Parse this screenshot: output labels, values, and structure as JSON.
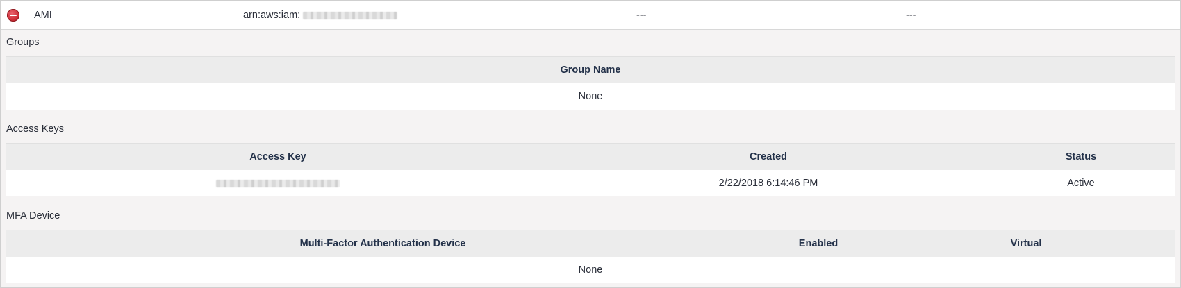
{
  "user_row": {
    "name": "AMI",
    "arn_prefix": "arn:aws:iam:",
    "col3": "---",
    "col4": "---"
  },
  "groups": {
    "title": "Groups",
    "headers": [
      "Group Name"
    ],
    "rows": [
      [
        "None"
      ]
    ]
  },
  "access_keys": {
    "title": "Access Keys",
    "headers": [
      "Access Key",
      "Created",
      "Status"
    ],
    "rows": [
      [
        "",
        "2/22/2018 6:14:46 PM",
        "Active"
      ]
    ]
  },
  "mfa": {
    "title": "MFA Device",
    "headers": [
      "Multi-Factor Authentication Device",
      "Enabled",
      "Virtual"
    ],
    "empty": "None"
  },
  "icons": {
    "remove": "remove-circle-icon"
  }
}
